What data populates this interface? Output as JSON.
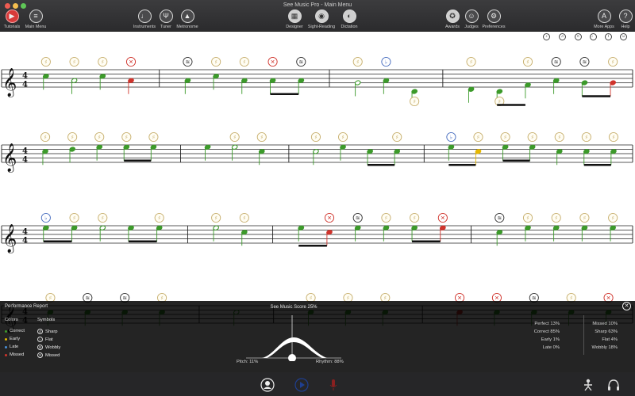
{
  "window": {
    "title": "See Music Pro - Main Menu",
    "traffic_colors": [
      "#ee5c52",
      "#f5bf4f",
      "#5fc757"
    ]
  },
  "toolbar": {
    "left": [
      {
        "icon": "youtube-icon",
        "label": "Tutorials"
      },
      {
        "icon": "menu-icon",
        "label": "Main Menu"
      }
    ],
    "center_left": [
      {
        "icon": "guitar-icon",
        "label": "Instruments"
      },
      {
        "icon": "tuning-fork-icon",
        "label": "Tuner"
      },
      {
        "icon": "metronome-icon",
        "label": "Metronome"
      }
    ],
    "center": [
      {
        "icon": "piano-icon",
        "label": "Designer"
      },
      {
        "icon": "eye-score-icon",
        "label": "Sight-Reading"
      },
      {
        "icon": "ear-icon",
        "label": "Dictation"
      }
    ],
    "right": [
      {
        "icon": "award-icon",
        "label": "Awards"
      },
      {
        "icon": "judges-icon",
        "label": "Judges"
      },
      {
        "icon": "preferences-icon",
        "label": "Preferences"
      }
    ],
    "far_right": [
      {
        "icon": "more-apps-icon",
        "label": "More Apps"
      },
      {
        "icon": "help-icon",
        "label": "Help"
      }
    ]
  },
  "score_controls": [
    "solfege-icon",
    "note-names-icon",
    "copyright-icon",
    "tempo-icon",
    "info-icon",
    "smiley-icon"
  ],
  "colors": {
    "correct": "#3c9a2a",
    "early": "#e6b800",
    "late": "#4a8fd6",
    "missed": "#d0342c",
    "sharp": "#c8b070",
    "flat": "#4a6fc0",
    "wobbly": "#333333",
    "missed_symbol": "#d0342c"
  },
  "panel": {
    "title": "Performance Report",
    "score_label": "See Music Score",
    "score_value": "25%",
    "colors_heading": "Colors",
    "symbols_heading": "Symbols",
    "color_legend": [
      {
        "label": "Correct",
        "color": "#3c9a2a"
      },
      {
        "label": "Early",
        "color": "#e6b800"
      },
      {
        "label": "Late",
        "color": "#4a8fd6"
      },
      {
        "label": "Missed",
        "color": "#d0342c"
      }
    ],
    "symbol_legend": [
      {
        "label": "Sharp",
        "glyph": "♯"
      },
      {
        "label": "Flat",
        "glyph": "♭"
      },
      {
        "label": "Wobbly",
        "glyph": "≋"
      },
      {
        "label": "Missed",
        "glyph": "✕"
      }
    ],
    "timing_stats": [
      {
        "label": "Perfect",
        "value": "13%"
      },
      {
        "label": "Correct",
        "value": "85%"
      },
      {
        "label": "Early",
        "value": "1%"
      },
      {
        "label": "Late",
        "value": "0%"
      }
    ],
    "pitch_stats": [
      {
        "label": "Missed",
        "value": "10%"
      },
      {
        "label": "Sharp",
        "value": "63%"
      },
      {
        "label": "Flat",
        "value": "4%"
      },
      {
        "label": "Wobbly",
        "value": "18%"
      }
    ],
    "pitch_label": "Pitch: 11%",
    "rhythm_label": "Rhythm: 88%"
  },
  "bottombar": {
    "icons": [
      "singer-icon",
      "play-icon",
      "microphone-icon",
      "figure-icon",
      "headphones-icon"
    ]
  },
  "systems": [
    {
      "notes": [
        {
          "pos": 1,
          "c": "g",
          "m": "s"
        },
        {
          "pos": -1,
          "c": "g",
          "m": "s",
          "half": true
        },
        {
          "pos": 1,
          "c": "g",
          "m": "s"
        },
        {
          "pos": -1,
          "c": "r",
          "m": "x"
        },
        {
          "bar": true
        },
        {
          "pos": -1,
          "c": "g",
          "m": "w"
        },
        {
          "pos": 1,
          "c": "g",
          "m": "s"
        },
        {
          "pos": -1,
          "c": "g",
          "m": "s"
        },
        {
          "pos": -1,
          "c": "g",
          "m": "x",
          "beam": "a"
        },
        {
          "pos": -1,
          "c": "g",
          "m": "w",
          "beam": "a"
        },
        {
          "bar": true
        },
        {
          "pos": -2,
          "c": "g",
          "m": "s",
          "half": true
        },
        {
          "pos": -1,
          "c": "g",
          "m": "f"
        },
        {
          "pos": -6,
          "c": "g",
          "m": "s",
          "below": true
        },
        {
          "bar": true
        },
        {
          "pos": -5,
          "c": "g",
          "m": "s"
        },
        {
          "pos": -6,
          "c": "g",
          "m": "s",
          "below": true,
          "beam": "b"
        },
        {
          "pos": -3,
          "c": "g",
          "m": "s",
          "beam": "b"
        },
        {
          "pos": -1,
          "c": "g",
          "m": "w"
        },
        {
          "pos": -2,
          "c": "g",
          "m": "w",
          "beam": "c"
        },
        {
          "pos": -2,
          "c": "r",
          "m": "s",
          "beam": "c"
        }
      ]
    },
    {
      "notes": [
        {
          "pos": 1,
          "c": "g",
          "m": "s"
        },
        {
          "pos": 2,
          "c": "g",
          "m": "s"
        },
        {
          "pos": 3,
          "c": "g",
          "m": "s"
        },
        {
          "pos": 3,
          "c": "g",
          "m": "s",
          "beam": "a"
        },
        {
          "pos": 3,
          "c": "g",
          "m": "s",
          "beam": "a"
        },
        {
          "bar": true
        },
        {
          "pos": 3,
          "c": "g",
          "m": "n"
        },
        {
          "pos": 3,
          "c": "g",
          "m": "s",
          "half": true
        },
        {
          "pos": 1,
          "c": "g",
          "m": "s"
        },
        {
          "bar": true
        },
        {
          "pos": 1,
          "c": "g",
          "m": "s",
          "half": true
        },
        {
          "pos": 3,
          "c": "g",
          "m": "s"
        },
        {
          "pos": 1,
          "c": "g",
          "m": "n",
          "beam": "b"
        },
        {
          "pos": 1,
          "c": "g",
          "m": "s",
          "beam": "b"
        },
        {
          "bar": true
        },
        {
          "pos": 3,
          "c": "g",
          "m": "f",
          "beam": "c"
        },
        {
          "pos": 1,
          "c": "y",
          "m": "s",
          "beam": "c"
        },
        {
          "pos": 3,
          "c": "g",
          "m": "s",
          "beam": "d"
        },
        {
          "pos": 3,
          "c": "g",
          "m": "s",
          "beam": "d"
        },
        {
          "pos": 1,
          "c": "g",
          "m": "s"
        },
        {
          "pos": 1,
          "c": "g",
          "m": "s",
          "beam": "e"
        },
        {
          "pos": 1,
          "c": "g",
          "m": "s",
          "beam": "e"
        }
      ]
    },
    {
      "notes": [
        {
          "pos": 3,
          "c": "g",
          "m": "f",
          "beam": "a"
        },
        {
          "pos": 3,
          "c": "g",
          "m": "s",
          "beam": "a"
        },
        {
          "pos": 3,
          "c": "g",
          "m": "s",
          "half": true
        },
        {
          "pos": 3,
          "c": "g",
          "m": "n",
          "beam": "b"
        },
        {
          "pos": 3,
          "c": "g",
          "m": "s",
          "beam": "b"
        },
        {
          "bar": true
        },
        {
          "pos": 3,
          "c": "g",
          "m": "s",
          "half": true
        },
        {
          "pos": 1,
          "c": "g",
          "m": "s"
        },
        {
          "bar": true
        },
        {
          "pos": 3,
          "c": "g",
          "m": "n",
          "beam": "c"
        },
        {
          "pos": 1,
          "c": "r",
          "m": "x",
          "beam": "c"
        },
        {
          "pos": 3,
          "c": "g",
          "m": "w"
        },
        {
          "pos": 3,
          "c": "g",
          "m": "s"
        },
        {
          "pos": 3,
          "c": "g",
          "m": "s",
          "beam": "d"
        },
        {
          "pos": 3,
          "c": "r",
          "m": "x",
          "beam": "d"
        },
        {
          "bar": true
        },
        {
          "pos": 1,
          "c": "g",
          "m": "w"
        },
        {
          "pos": 3,
          "c": "g",
          "m": "s"
        },
        {
          "pos": 3,
          "c": "g",
          "m": "s"
        },
        {
          "pos": 3,
          "c": "g",
          "m": "s"
        },
        {
          "pos": 3,
          "c": "g",
          "m": "s"
        }
      ]
    },
    {
      "notes": [
        {
          "pos": 1,
          "c": "g",
          "m": "s"
        },
        {
          "pos": 1,
          "c": "g",
          "m": "w"
        },
        {
          "pos": 1,
          "c": "g",
          "m": "w"
        },
        {
          "pos": 1,
          "c": "g",
          "m": "s"
        },
        {
          "bar": true
        },
        {
          "pos": 1,
          "c": "g",
          "m": "n",
          "half": true
        },
        {
          "bar": true
        },
        {
          "pos": 1,
          "c": "g",
          "m": "s"
        },
        {
          "pos": 1,
          "c": "g",
          "m": "s"
        },
        {
          "pos": 1,
          "c": "g",
          "m": "s"
        },
        {
          "bar": true
        },
        {
          "pos": 1,
          "c": "r",
          "m": "x"
        },
        {
          "pos": 1,
          "c": "g",
          "m": "x"
        },
        {
          "pos": 1,
          "c": "g",
          "m": "w"
        },
        {
          "pos": 1,
          "c": "g",
          "m": "s"
        },
        {
          "pos": 1,
          "c": "g",
          "m": "x"
        }
      ]
    }
  ]
}
